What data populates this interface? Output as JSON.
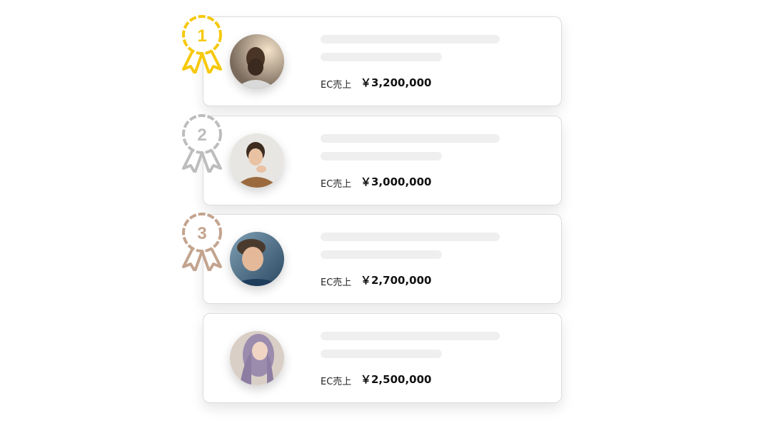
{
  "ranking": {
    "items": [
      {
        "rank": "1",
        "label": "EC売上",
        "value": "￥3,200,000",
        "medal_color": "#f6c90e",
        "avatar": "person-bearded-man"
      },
      {
        "rank": "2",
        "label": "EC売上",
        "value": "￥3,000,000",
        "medal_color": "#bdbdbd",
        "avatar": "person-woman-brown-sweater"
      },
      {
        "rank": "3",
        "label": "EC売上",
        "value": "￥2,700,000",
        "medal_color": "#c3a48e",
        "avatar": "person-smiling-man"
      },
      {
        "label": "EC売上",
        "value": "￥2,500,000",
        "avatar": "person-woman-lavender-hair"
      }
    ]
  }
}
